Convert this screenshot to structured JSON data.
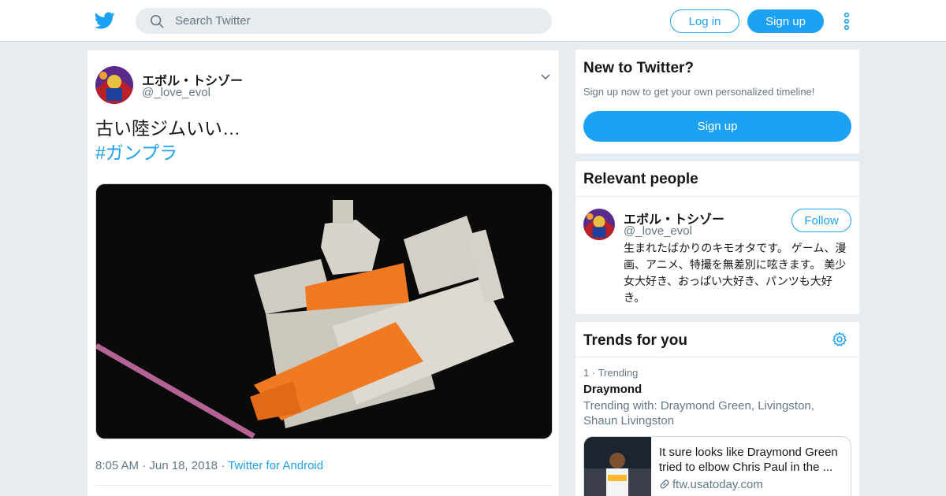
{
  "header": {
    "search_placeholder": "Search Twitter",
    "login_label": "Log in",
    "signup_label": "Sign up"
  },
  "tweet": {
    "author_name": "エボル・トシゾー",
    "author_handle": "@_love_evol",
    "text": "古い陸ジムいい…",
    "hashtag": "#ガンプラ",
    "time": "8:05 AM",
    "date": "Jun 18, 2018",
    "source": "Twitter for Android"
  },
  "new_to_twitter": {
    "title": "New to Twitter?",
    "subtitle": "Sign up now to get your own personalized timeline!",
    "button": "Sign up"
  },
  "relevant_people": {
    "title": "Relevant people",
    "name": "エボル・トシゾー",
    "handle": "@_love_evol",
    "follow_label": "Follow",
    "bio": "生まれたばかりのキモオタです。 ゲーム、漫画、アニメ、特撮を無差別に呟きます。 美少女大好き、おっぱい大好き、パンツも大好き。"
  },
  "trends": {
    "title": "Trends for you",
    "rank": "1",
    "category": "Trending",
    "name": "Draymond",
    "trending_with": "Trending with: Draymond Green, Livingston, Shaun Livingston",
    "news_headline": "It sure looks like Draymond Green tried to elbow Chris Paul in the ...",
    "news_domain": "ftw.usatoday.com"
  },
  "colors": {
    "accent": "#1da1f2",
    "background": "#e6ecf0",
    "secondary_text": "#657786"
  }
}
